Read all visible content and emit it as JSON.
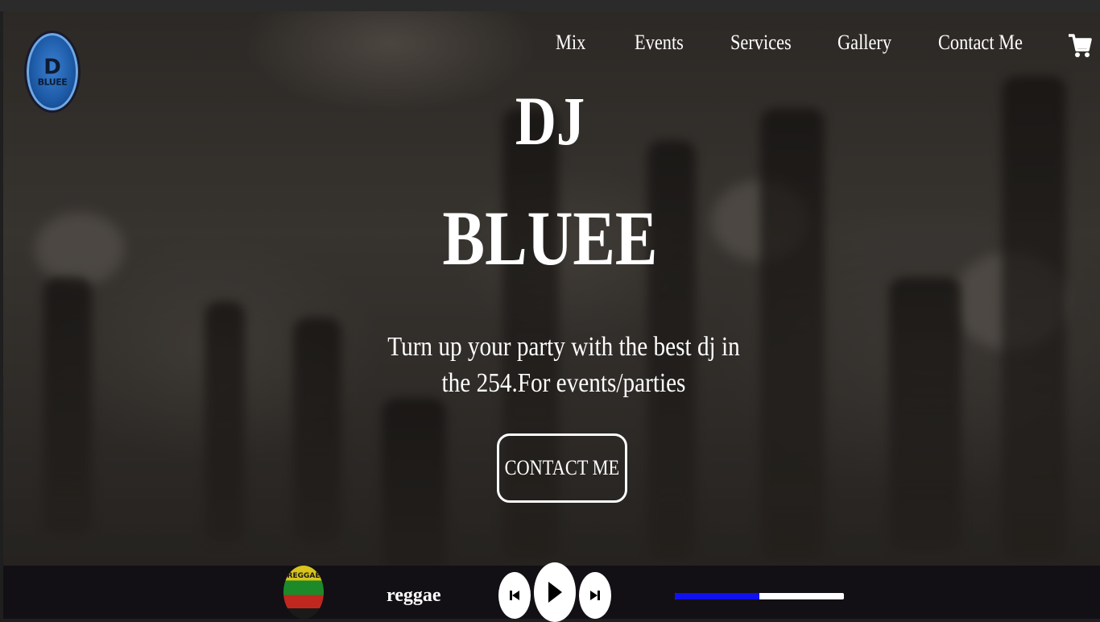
{
  "logo": {
    "mark": "D",
    "text": "BLUEE"
  },
  "nav": {
    "items": [
      {
        "label": "Mix"
      },
      {
        "label": "Events"
      },
      {
        "label": "Services"
      },
      {
        "label": "Gallery"
      },
      {
        "label": "Contact Me"
      }
    ],
    "cart_icon": "shopping-cart-icon"
  },
  "hero": {
    "title_line1": "DJ",
    "title_line2": "BLUEE",
    "tagline": "Turn up your party with the best dj in the 254.For events/parties",
    "cta_label": "CONTACT ME"
  },
  "player": {
    "album_art_text": "REGGAE",
    "track_name": "reggae",
    "prev_icon": "skip-previous-icon",
    "play_icon": "play-icon",
    "next_icon": "skip-next-icon",
    "progress": 0.5,
    "progress_fill_color": "#1010f0",
    "progress_track_color": "#ffffff"
  },
  "colors": {
    "hero_text": "#ffffff",
    "player_bg": "#121015",
    "logo_blue": "#1d5aa6"
  }
}
